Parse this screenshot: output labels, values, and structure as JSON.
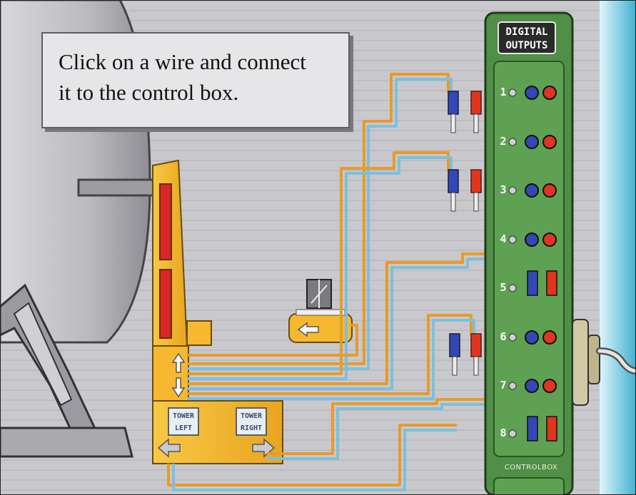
{
  "instruction": {
    "line1": "Click on a wire and connect",
    "line2": "it to the control box."
  },
  "control_box": {
    "title_line1": "DIGITAL",
    "title_line2": "OUTPUTS",
    "label": "CONTROLBOX",
    "ports": [
      {
        "number": "1"
      },
      {
        "number": "2"
      },
      {
        "number": "3"
      },
      {
        "number": "4"
      },
      {
        "number": "5"
      },
      {
        "number": "6"
      },
      {
        "number": "7"
      },
      {
        "number": "8"
      }
    ]
  },
  "tower_buttons": {
    "left_line1": "TOWER",
    "left_line2": "LEFT",
    "right_line1": "TOWER",
    "right_line2": "RIGHT"
  },
  "colors": {
    "panel_green": "#4f8f46",
    "tower_yellow": "#f2b52c",
    "wire_orange": "#e89a2a",
    "wire_blue": "#7cc0dc",
    "plug_red": "#e0351f",
    "plug_blue": "#3348b5"
  }
}
